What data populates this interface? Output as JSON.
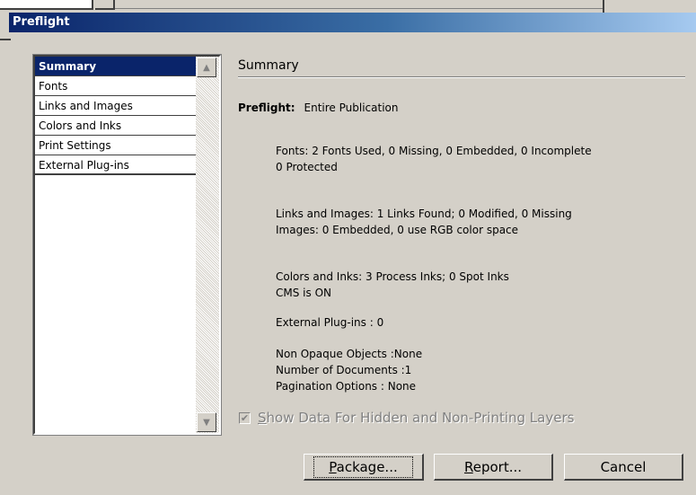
{
  "window": {
    "title": "Preflight"
  },
  "sidebar": {
    "items": [
      {
        "label": "Summary",
        "selected": true
      },
      {
        "label": "Fonts"
      },
      {
        "label": "Links and Images"
      },
      {
        "label": "Colors and Inks"
      },
      {
        "label": "Print Settings"
      },
      {
        "label": "External Plug-ins"
      }
    ]
  },
  "main": {
    "heading": "Summary",
    "preflight_label": "Preflight:",
    "preflight_value": "Entire Publication",
    "fonts_line1": "Fonts: 2 Fonts Used, 0 Missing, 0 Embedded, 0 Incomplete",
    "fonts_line2": "0 Protected",
    "links_line1": "Links and Images: 1 Links Found; 0 Modified, 0 Missing",
    "links_line2": "Images: 0 Embedded, 0 use RGB color space",
    "colors_line1": "Colors and Inks: 3 Process Inks; 0 Spot Inks",
    "colors_line2": "CMS is ON",
    "plugins_line": "External Plug-ins : 0",
    "non_opaque": "Non Opaque Objects :None",
    "num_docs": "Number of Documents :1",
    "pagination": "Pagination Options : None"
  },
  "options": {
    "show_hidden_accel": "S",
    "show_hidden_rest": "how Data For Hidden and Non-Printing Layers",
    "show_hidden_checked": true
  },
  "buttons": {
    "package_accel": "P",
    "package_rest": "ackage...",
    "report_accel": "R",
    "report_rest": "eport...",
    "cancel": "Cancel"
  },
  "colors": {
    "title_bar_start": "#0a246a",
    "title_bar_end": "#a6caf0",
    "dialog_bg": "#d4d0c8",
    "selection": "#0a246a"
  }
}
